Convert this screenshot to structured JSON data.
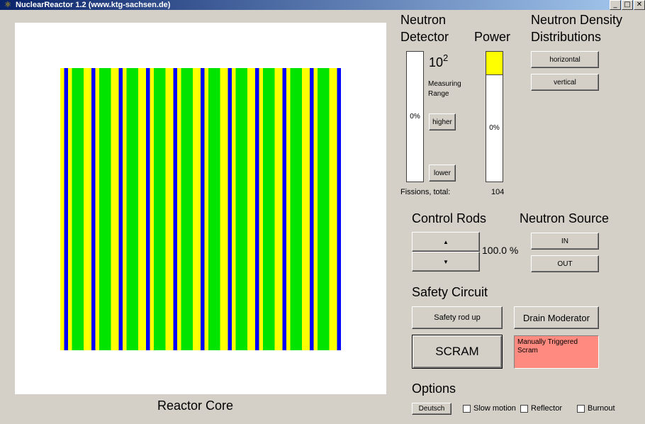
{
  "window": {
    "title": "NuclearReactor 1.2 (www.ktg-sachsen.de)",
    "icon": "reactor-app-icon"
  },
  "core": {
    "label": "Reactor Core",
    "stripe_pattern": [
      "yellow",
      "blue",
      "yellow",
      "green",
      "green",
      "green",
      "yellow"
    ],
    "colors": {
      "fuel": "#00e400",
      "moderator": "#ffff00",
      "rod": "#0000ff"
    }
  },
  "detector": {
    "title_line1": "Neutron",
    "title_line2": "Detector",
    "reading": "0%",
    "range_base": "10",
    "range_exp": "2",
    "range_label_1": "Measuring",
    "range_label_2": "Range",
    "higher": "higher",
    "lower": "lower"
  },
  "power": {
    "title": "Power",
    "reading": "0%",
    "fill_fraction": 0.18,
    "fill_color": "#ffff00"
  },
  "fissions": {
    "label": "Fissions, total:",
    "value": "104"
  },
  "density": {
    "title_line1": "Neutron Density",
    "title_line2": "Distributions",
    "horizontal": "horizontal",
    "vertical": "vertical"
  },
  "control_rods": {
    "title": "Control Rods",
    "up": "▲",
    "down": "▼",
    "value": "100.0 %"
  },
  "neutron_source": {
    "title": "Neutron Source",
    "in": "IN",
    "out": "OUT"
  },
  "safety": {
    "title": "Safety Circuit",
    "rod_up": "Safety rod up",
    "drain": "Drain Moderator",
    "scram": "SCRAM",
    "message": "Manually Triggered Scram",
    "message_color": "#ff8a80"
  },
  "options": {
    "title": "Options",
    "language": "Deutsch",
    "checkboxes": [
      {
        "label": "Slow motion",
        "checked": false
      },
      {
        "label": "Reflector",
        "checked": false
      },
      {
        "label": "Burnout",
        "checked": false
      }
    ]
  }
}
